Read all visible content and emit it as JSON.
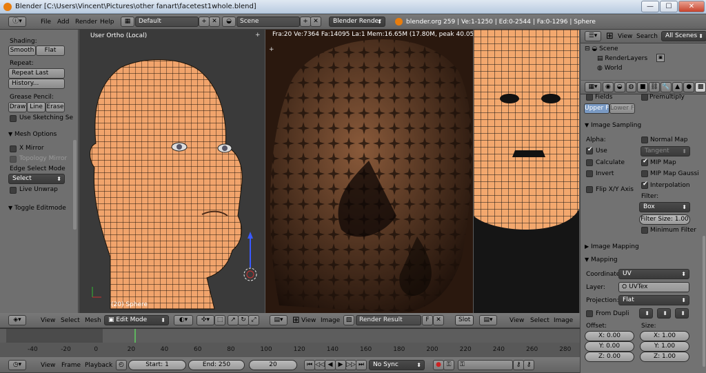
{
  "window": {
    "title": "Blender [C:\\Users\\Vincent\\Pictures\\other fanart\\facetest1whole.blend]",
    "minimize": "—",
    "maximize": "☐",
    "close": "✕"
  },
  "info_header": {
    "menus": [
      "File",
      "Add",
      "Render",
      "Help"
    ],
    "screen": "Default",
    "scene": "Scene",
    "engine": "Blender Render",
    "stats": "blender.org 259 | Ve:1-1250 | Ed:0-2544 | Fa:0-1296 | Sphere"
  },
  "toolshelf": {
    "shading_label": "Shading:",
    "smooth": "Smooth",
    "flat": "Flat",
    "repeat_label": "Repeat:",
    "repeat_last": "Repeat Last",
    "history": "History...",
    "grease_label": "Grease Pencil:",
    "draw": "Draw",
    "line": "Line",
    "erase": "Erase",
    "use_sketching": "Use Sketching Se",
    "mesh_options": "Mesh Options",
    "x_mirror": "X Mirror",
    "topology_mirror": "Topology Mirror",
    "edge_select_mode": "Edge Select Mode",
    "select": "Select",
    "live_unwrap": "Live Unwrap",
    "toggle_editmode": "Toggle Editmode"
  },
  "viewport3d": {
    "view_label": "User Ortho (Local)",
    "object_label": "(20) Sphere"
  },
  "render_view": {
    "stats": "Fra:20  Ve:7364 Fa:14095 La:1 Mem:16.65M (17.80M, peak 40.05M) Time"
  },
  "outliner": {
    "menus": [
      "View",
      "Search"
    ],
    "scope": "All Scenes",
    "items": [
      "Scene",
      "RenderLayers",
      "World"
    ]
  },
  "properties": {
    "fields": "Fields",
    "premultiply": "Premultiply",
    "upper_first": "Upper Fir",
    "lower_first": "Lower Fir",
    "image_sampling": "Image Sampling",
    "alpha": "Alpha:",
    "use": "Use",
    "calculate": "Calculate",
    "invert": "Invert",
    "flip_xy": "Flip X/Y Axis",
    "normal_map": "Normal Map",
    "tangent": "Tangent",
    "mip_map": "MIP Map",
    "mip_map_gauss": "MIP Map Gaussi",
    "interpolation": "Interpolation",
    "filter_label": "Filter:",
    "filter": "Box",
    "filter_size": "Filter Size: 1.00",
    "minimum_filter": "Minimum Filter",
    "image_mapping": "Image Mapping",
    "mapping": "Mapping",
    "coordinate_label": "Coordinate",
    "coordinate": "UV",
    "layer_label": "Layer:",
    "layer": "UVTex",
    "projection_label": "Projection:",
    "projection": "Flat",
    "from_dupli": "From Dupli",
    "offset_label": "Offset:",
    "size_label": "Size:",
    "ox": "X: 0.00",
    "oy": "Y: 0.00",
    "oz": "Z: 0.00",
    "sx": "X: 1.00",
    "sy": "Y: 1.00",
    "sz": "Z: 1.00"
  },
  "view3d_header": {
    "menus": [
      "View",
      "Select",
      "Mesh"
    ],
    "mode": "Edit Mode"
  },
  "image_header": {
    "menus": [
      "View",
      "Image"
    ],
    "image": "Render Result",
    "f": "F",
    "slot": "Slot 1"
  },
  "uv_header": {
    "menus": [
      "View",
      "Select",
      "Image"
    ]
  },
  "timeline": {
    "ticks": [
      "-40",
      "-20",
      "0",
      "20",
      "40",
      "60",
      "80",
      "100",
      "120",
      "140",
      "160",
      "180",
      "200",
      "220",
      "240",
      "260",
      "280"
    ]
  },
  "timeline_header": {
    "menus": [
      "View",
      "Frame",
      "Playback"
    ],
    "start": "Start: 1",
    "end": "End: 250",
    "current": "20",
    "sync": "No Sync"
  }
}
